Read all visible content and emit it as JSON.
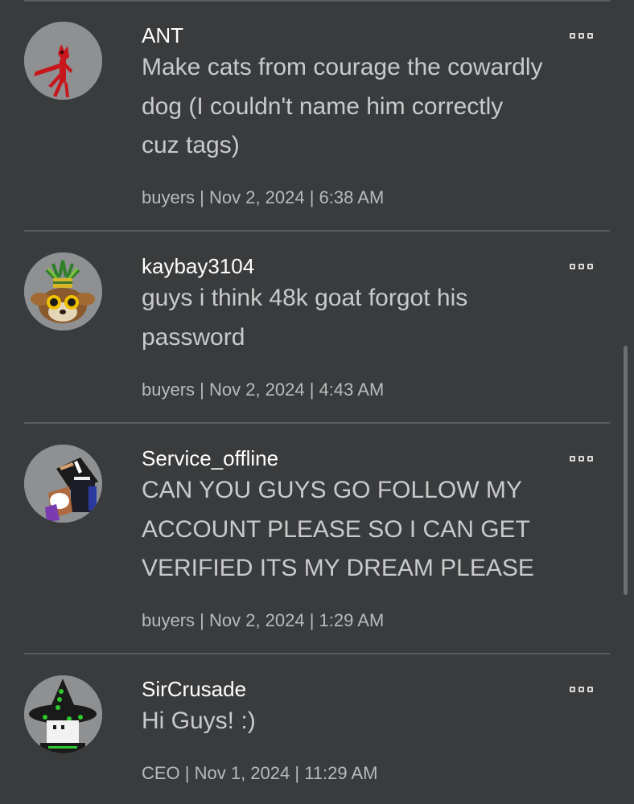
{
  "comments": [
    {
      "username": "ANT",
      "text": "Make cats from courage the cowardly\ndog (I couldn't name him correctly\ncuz tags)",
      "meta": "buyers | Nov 2, 2024 | 6:38 AM",
      "avatar_icon": "red-cat-avatar-icon"
    },
    {
      "username": "kaybay3104",
      "text": "guys i think 48k goat forgot his\npassword",
      "meta": "buyers | Nov 2, 2024 | 4:43 AM",
      "avatar_icon": "lemur-king-avatar-icon"
    },
    {
      "username": "Service_offline",
      "text": "CAN YOU GUYS GO FOLLOW MY\nACCOUNT PLEASE SO I CAN GET\nVERIFIED ITS MY DREAM PLEASE",
      "meta": "buyers | Nov 2, 2024 | 1:29 AM",
      "avatar_icon": "hat-avatar-icon"
    },
    {
      "username": "SirCrusade",
      "text": "Hi Guys! :)",
      "meta": "CEO | Nov 1, 2024 | 11:29 AM",
      "avatar_icon": "witch-hat-avatar-icon"
    }
  ],
  "colors": {
    "background": "#393b3d",
    "username": "#ffffff",
    "body_text": "#c9cacb",
    "meta_text": "#b9babb",
    "divider": "#5a5c5e",
    "avatar_bg": "#8e9092"
  }
}
